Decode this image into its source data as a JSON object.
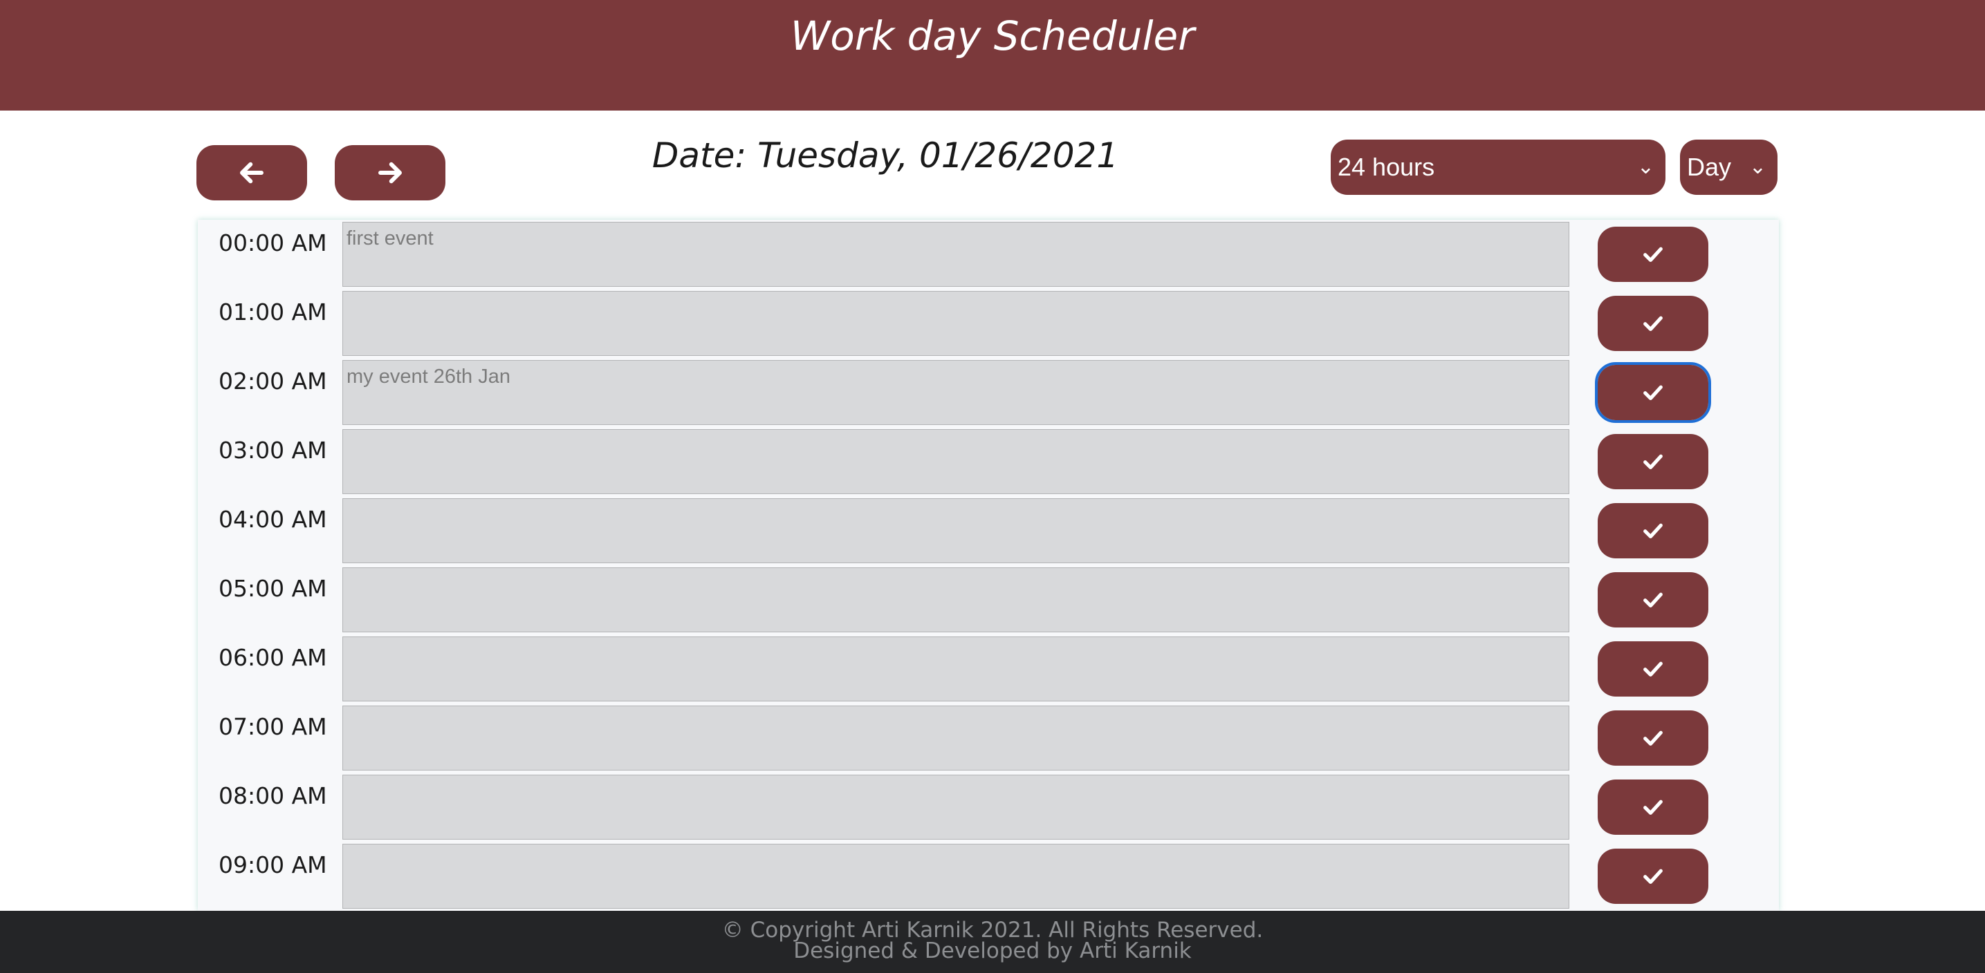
{
  "header": {
    "title": "Work day Scheduler"
  },
  "nav": {
    "prev_icon": "arrow-left-icon",
    "next_icon": "arrow-right-icon"
  },
  "date_line": "Date: Tuesday, 01/26/2021",
  "hours_select": {
    "value": "24 hours"
  },
  "view_select": {
    "value": "Day"
  },
  "rows": [
    {
      "time": "00:00 AM",
      "event": "first event"
    },
    {
      "time": "01:00 AM",
      "event": ""
    },
    {
      "time": "02:00 AM",
      "event": "my event 26th Jan"
    },
    {
      "time": "03:00 AM",
      "event": ""
    },
    {
      "time": "04:00 AM",
      "event": ""
    },
    {
      "time": "05:00 AM",
      "event": ""
    },
    {
      "time": "06:00 AM",
      "event": ""
    },
    {
      "time": "07:00 AM",
      "event": ""
    },
    {
      "time": "08:00 AM",
      "event": ""
    },
    {
      "time": "09:00 AM",
      "event": ""
    }
  ],
  "save_icon": "check-icon",
  "focused_row": 2,
  "footer": {
    "line1": "© Copyright Arti Karnik 2021. All Rights Reserved.",
    "line2": "Designed & Developed by Arti Karnik"
  },
  "colors": {
    "brand": "#7b393b",
    "event_bg": "#d8d9db",
    "footer_bg": "#242527",
    "focus_ring": "#1f6fd6"
  }
}
